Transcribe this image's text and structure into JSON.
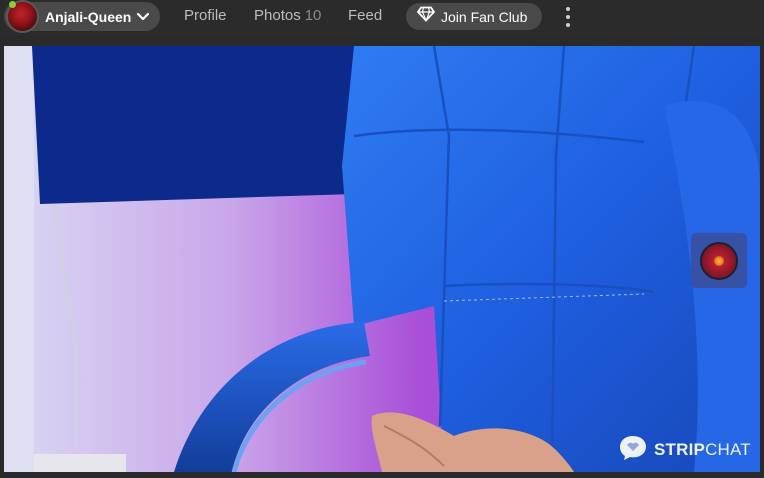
{
  "header": {
    "username": "Anjali-Queen",
    "online": true,
    "nav": {
      "profile": "Profile",
      "photos": "Photos",
      "photos_count": "10",
      "feed": "Feed"
    },
    "fan_club_label": "Join Fan Club"
  },
  "watermark": {
    "brand_bold": "STRIP",
    "brand_light": "CHAT"
  },
  "icons": {
    "avatar": "avatar",
    "dropdown": "chevron-down-icon",
    "fan_club": "diamond-icon",
    "more": "kebab-menu-icon",
    "wheel": "fortune-wheel-icon",
    "brand": "chat-bubble-logo-icon"
  },
  "colors": {
    "topbar": "#2b2b2b",
    "pill": "#4a4a4a",
    "online": "#8ccf3a",
    "chair_blue": "#1f5fe0",
    "wall_purple": "#a84fd6"
  }
}
